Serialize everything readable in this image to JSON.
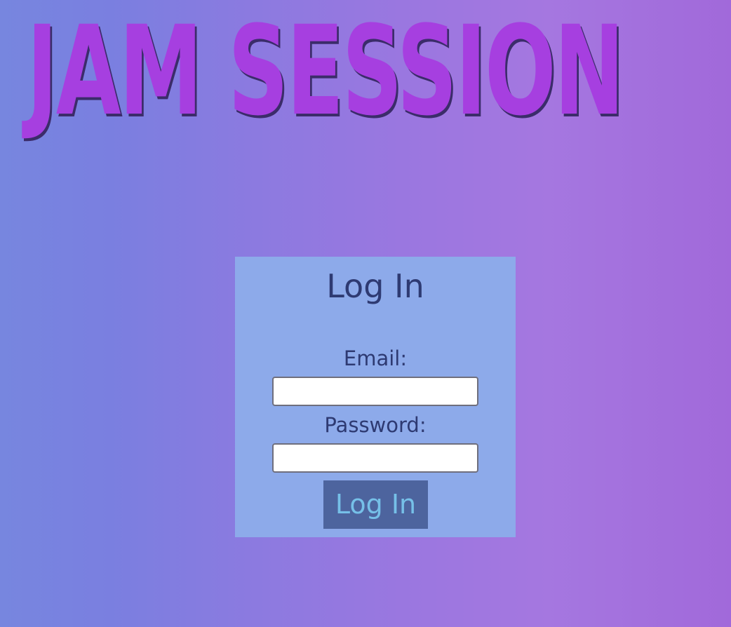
{
  "app": {
    "title": "JAM SESSION"
  },
  "login": {
    "heading": "Log In",
    "email_label": "Email:",
    "email_value": "",
    "password_label": "Password:",
    "password_value": "",
    "submit_label": "Log In"
  },
  "colors": {
    "title": "#a63fe0",
    "title_shadow": "#3b2c6a",
    "panel_background": "#8daaea",
    "text": "#2e3a72",
    "button_background": "#4d649e",
    "button_text": "#76c0e8"
  }
}
